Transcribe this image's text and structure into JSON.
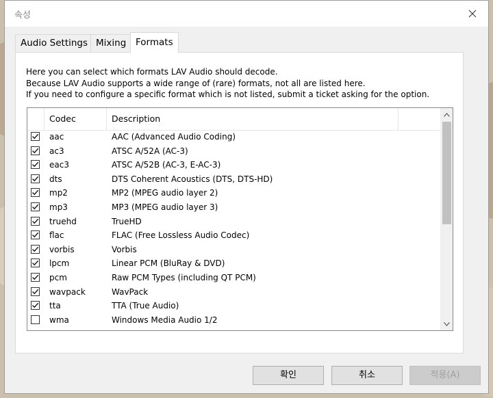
{
  "window": {
    "title": "속성"
  },
  "tabs": [
    {
      "label": "Audio Settings"
    },
    {
      "label": "Mixing"
    },
    {
      "label": "Formats"
    }
  ],
  "description": [
    "Here you can select which formats LAV Audio should decode.",
    "Because LAV Audio supports a wide range of (rare) formats, not all are listed here.",
    "If you need to configure a specific format which is not listed, submit a ticket asking for the option."
  ],
  "table": {
    "columns": [
      "Codec",
      "Description"
    ],
    "rows": [
      {
        "checked": true,
        "codec": "aac",
        "description": "AAC (Advanced Audio Coding)"
      },
      {
        "checked": true,
        "codec": "ac3",
        "description": "ATSC A/52A (AC-3)"
      },
      {
        "checked": true,
        "codec": "eac3",
        "description": "ATSC A/52B (AC-3, E-AC-3)"
      },
      {
        "checked": true,
        "codec": "dts",
        "description": "DTS Coherent Acoustics (DTS, DTS-HD)"
      },
      {
        "checked": true,
        "codec": "mp2",
        "description": "MP2 (MPEG audio layer 2)"
      },
      {
        "checked": true,
        "codec": "mp3",
        "description": "MP3 (MPEG audio layer 3)"
      },
      {
        "checked": true,
        "codec": "truehd",
        "description": "TrueHD"
      },
      {
        "checked": true,
        "codec": "flac",
        "description": "FLAC (Free Lossless Audio Codec)"
      },
      {
        "checked": true,
        "codec": "vorbis",
        "description": "Vorbis"
      },
      {
        "checked": true,
        "codec": "lpcm",
        "description": "Linear PCM (BluRay & DVD)"
      },
      {
        "checked": true,
        "codec": "pcm",
        "description": "Raw PCM Types (including QT PCM)"
      },
      {
        "checked": true,
        "codec": "wavpack",
        "description": "WavPack"
      },
      {
        "checked": true,
        "codec": "tta",
        "description": "TTA (True Audio)"
      },
      {
        "checked": false,
        "codec": "wma",
        "description": "Windows Media Audio 1/2"
      }
    ]
  },
  "buttons": {
    "ok": "확인",
    "cancel": "취소",
    "apply": "적용(A)"
  }
}
